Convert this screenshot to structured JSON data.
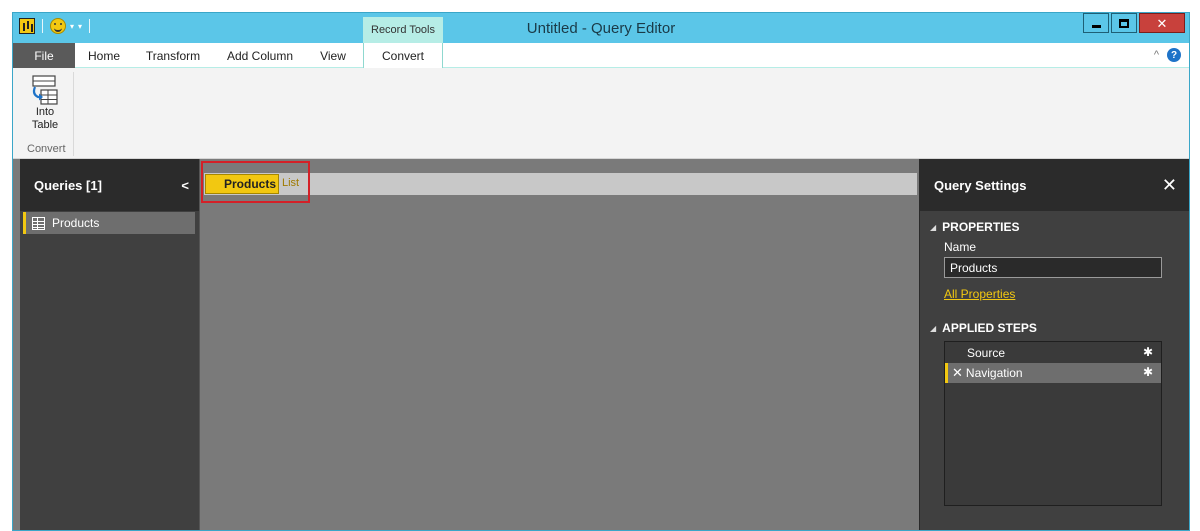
{
  "window": {
    "title": "Untitled - Query Editor"
  },
  "contextual_tab_group": "Record Tools",
  "ribbon_tabs": [
    "File",
    "Home",
    "Transform",
    "Add Column",
    "View",
    "Convert"
  ],
  "ribbon": {
    "into_table_label": "Into Table",
    "group_label": "Convert"
  },
  "queries_pane": {
    "title": "Queries [1]",
    "items": [
      {
        "label": "Products"
      }
    ]
  },
  "breadcrumb": {
    "current": "Products",
    "type": "List"
  },
  "query_settings": {
    "title": "Query Settings",
    "properties_title": "PROPERTIES",
    "name_label": "Name",
    "name_value": "Products",
    "all_properties_link": "All Properties",
    "applied_steps_title": "APPLIED STEPS",
    "steps": [
      {
        "label": "Source"
      },
      {
        "label": "Navigation"
      }
    ]
  },
  "colors": {
    "accent_yellow": "#f2c811",
    "titlebar_blue": "#5bc6e8",
    "highlight_red": "#d42027"
  }
}
